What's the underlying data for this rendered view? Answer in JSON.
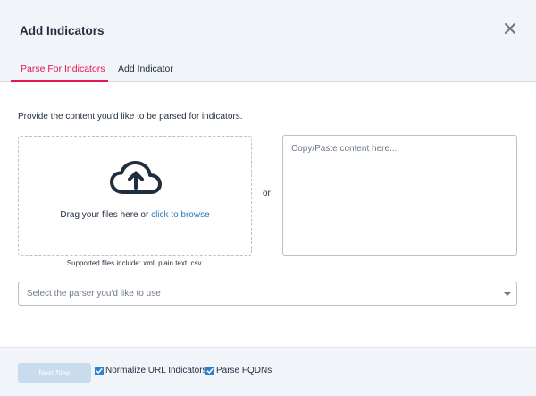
{
  "modal": {
    "title": "Add Indicators",
    "close_icon": "close-icon"
  },
  "tabs": [
    {
      "label": "Parse For Indicators",
      "active": true
    },
    {
      "label": "Add Indicator",
      "active": false
    }
  ],
  "parse": {
    "prompt": "Provide the content you'd like to be parsed for indicators.",
    "dropzone": {
      "icon": "cloud-upload-icon",
      "text": "Drag your files here or ",
      "link": "click to browse"
    },
    "supported": "Supported files include: xml, plain text, csv.",
    "or": "or",
    "paste_placeholder": "Copy/Paste content here...",
    "paste_value": "",
    "parser_select": {
      "placeholder": "Select the parser you'd like to use",
      "value": ""
    }
  },
  "footer": {
    "next_label": "Next Step",
    "next_enabled": false,
    "checkboxes": [
      {
        "label": "Normalize URL Indicators",
        "checked": true
      },
      {
        "label": "Parse FQDNs",
        "checked": true
      }
    ]
  },
  "colors": {
    "accent": "#e0184f",
    "link": "#2a7ab8",
    "checkbox": "#2f80d1",
    "header_bg": "#f1f4f8",
    "disabled_button": "#c8dcee"
  }
}
